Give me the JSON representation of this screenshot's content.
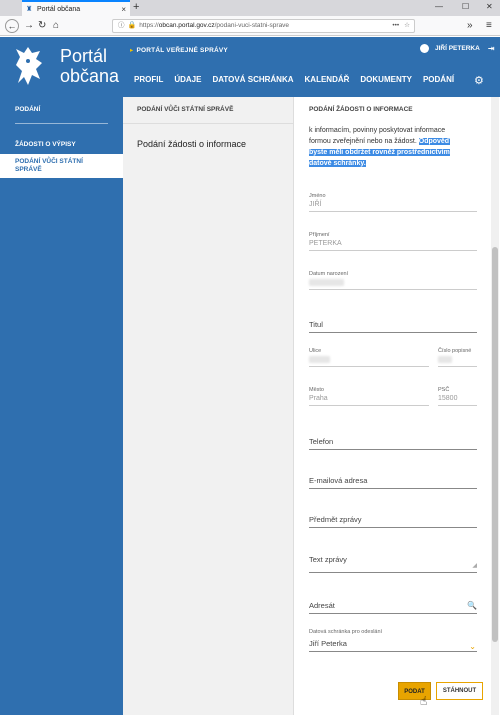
{
  "browser": {
    "tab_title": "Portál občana",
    "url_prefix": "https://",
    "url_domain": "obcan.portal.gov.cz",
    "url_path": "/podani-vuci-statni-sprave"
  },
  "header": {
    "logo_line1": "Portál",
    "logo_line2": "občana",
    "public_admin_link": "PORTÁL VEŘEJNÉ SPRÁVY",
    "user_name": "JIŘÍ PETERKA",
    "nav": [
      "PROFIL",
      "ÚDAJE",
      "DATOVÁ SCHRÁNKA",
      "KALENDÁŘ",
      "DOKUMENTY",
      "PODÁNÍ"
    ]
  },
  "sidebar": {
    "title": "PODÁNÍ",
    "items": [
      "ŽÁDOSTI O VÝPISY",
      "PODÁNÍ VŮČI STÁTNÍ SPRÁVĚ"
    ]
  },
  "middle": {
    "heading": "PODÁNÍ VŮČI STÁTNÍ SPRÁVĚ",
    "item": "Podání žádosti o informace"
  },
  "form": {
    "heading": "PODÁNÍ ŽÁDOSTI O INFORMACE",
    "info_line1": "k informacím, povinny poskytovat informace",
    "info_line2": "formou zveřejnění nebo na žádost.",
    "info_hl1": "Odpověď",
    "info_hl2": "byste měli obdržet rovněž prostřednictvím",
    "info_hl3": "datové schránky.",
    "jmeno_label": "Jméno",
    "jmeno_value": "JIŘÍ",
    "prijmeni_label": "Příjmení",
    "prijmeni_value": "PETERKA",
    "datum_label": "Datum narození",
    "titul_ph": "Titul",
    "ulice_label": "Ulice",
    "cislo_label": "Číslo popisné",
    "mesto_label": "Město",
    "mesto_value": "Praha",
    "psc_label": "PSČ",
    "psc_value": "15800",
    "telefon_ph": "Telefon",
    "email_ph": "E-mailová adresa",
    "predmet_ph": "Předmět zprávy",
    "text_ph": "Text zprávy",
    "adresat_ph": "Adresát",
    "ds_label": "Datová schránka pro odeslání",
    "ds_value": "Jiří Peterka",
    "submit_label": "PODAT",
    "download_label": "STÁHNOUT"
  },
  "colors": {
    "brand": "#2f6faf",
    "accent": "#e8a400",
    "highlight": "#3d8be4"
  }
}
